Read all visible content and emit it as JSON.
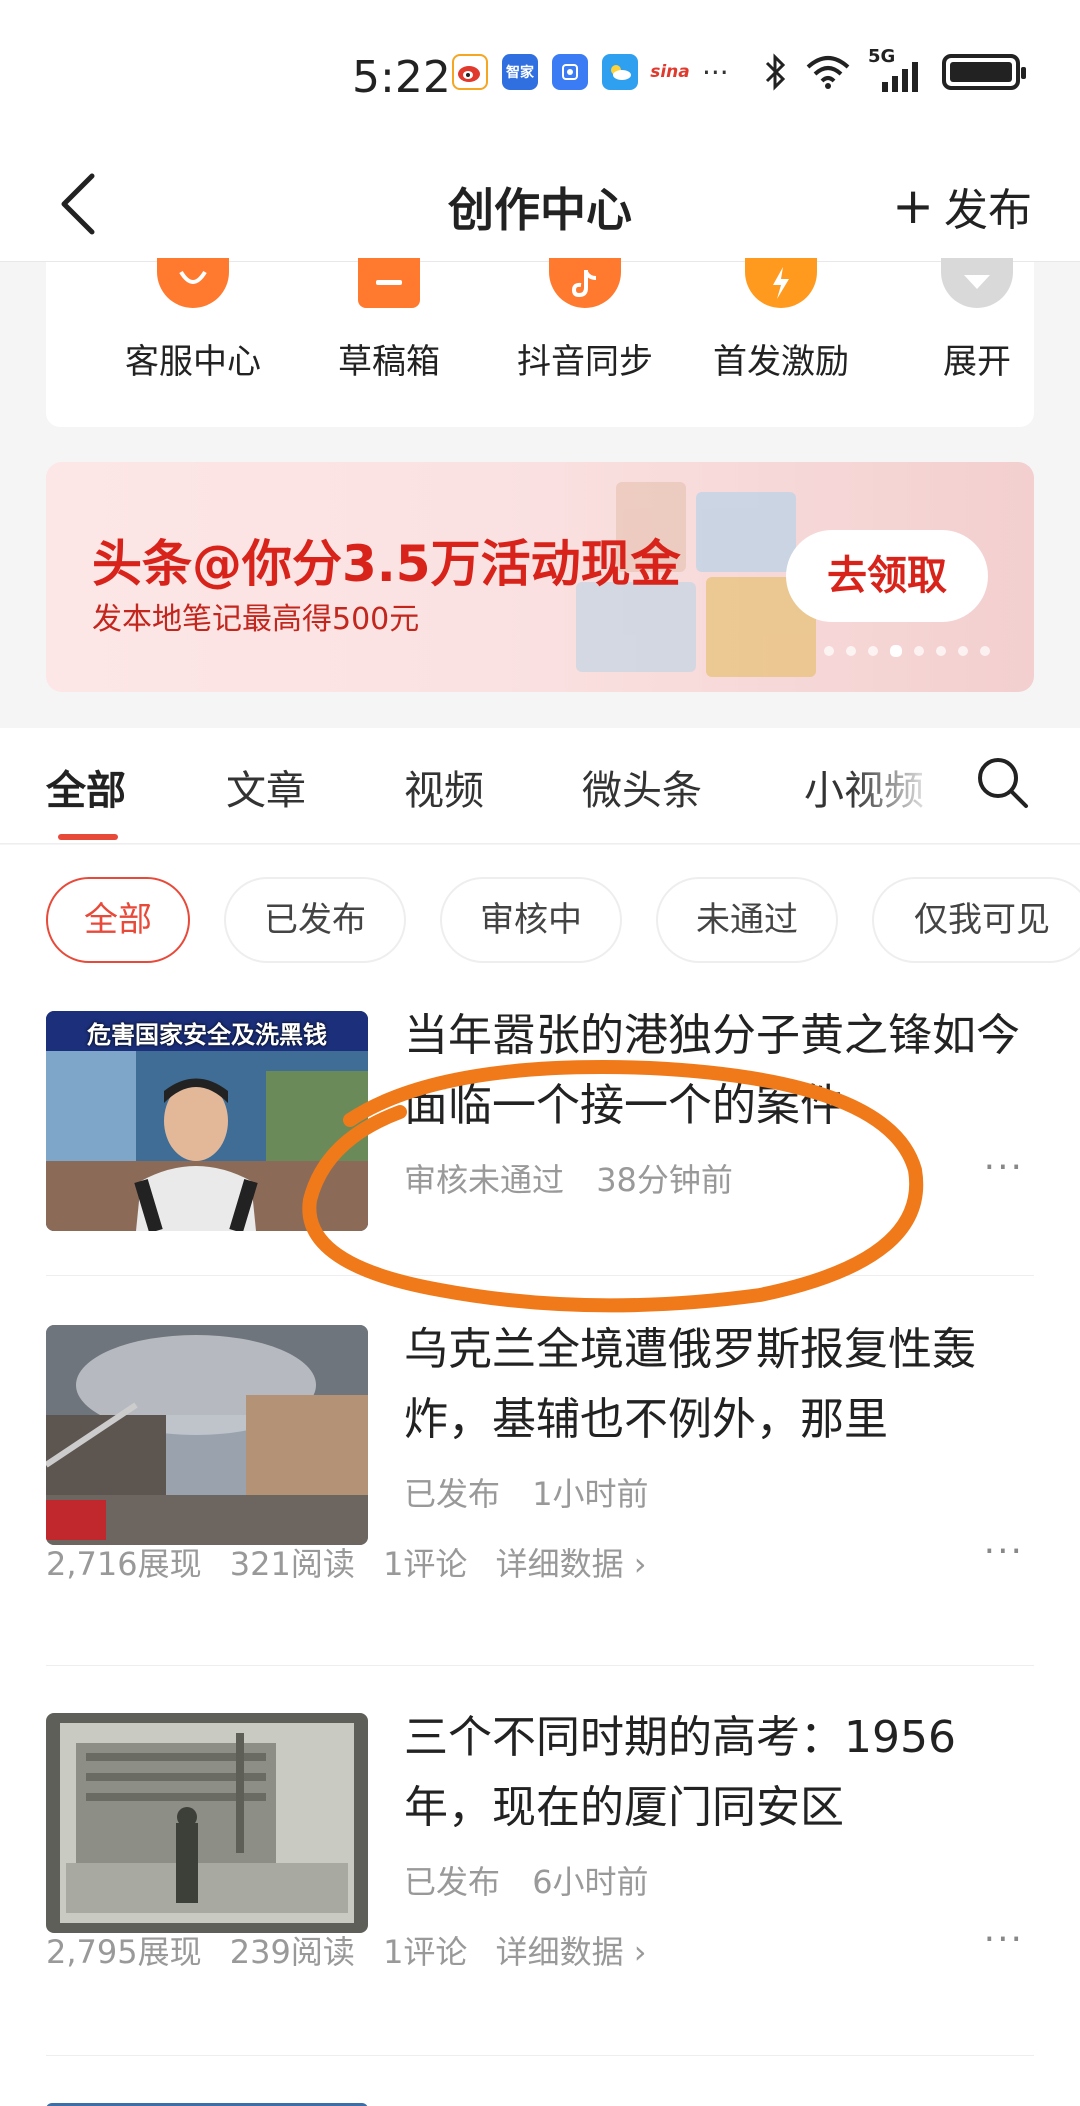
{
  "status_bar": {
    "time": "5:22",
    "apps": [
      {
        "icon": "weibo-app-icon",
        "color": "#f5a623"
      },
      {
        "icon": "zhijia-app-icon",
        "color": "#2f6fe0",
        "text": "智家"
      },
      {
        "icon": "hand-app-icon",
        "color": "#3b7cf5"
      },
      {
        "icon": "weather-app-icon",
        "color": "#2fa0f0"
      },
      {
        "icon": "sina-app-icon",
        "color": "#e03a2f",
        "text": "sina"
      }
    ],
    "more": "···",
    "network": "5G"
  },
  "header": {
    "title": "创作中心",
    "publish_label": "发布",
    "publish_icon": "plus-icon"
  },
  "tools": [
    {
      "label": "客服中心",
      "icon": "headset-icon",
      "color": "#ff7a2f"
    },
    {
      "label": "草稿箱",
      "icon": "draft-box-icon",
      "color": "#ff7a2f"
    },
    {
      "label": "抖音同步",
      "icon": "douyin-icon",
      "color": "#ff7a2f"
    },
    {
      "label": "首发激励",
      "icon": "incentive-icon",
      "color": "#ff9a1f"
    },
    {
      "label": "展开",
      "icon": "expand-icon",
      "color": "#d9d9d9"
    }
  ],
  "banner": {
    "title": "头条@你分3.5万活动现金",
    "subtitle": "发本地笔记最高得500元",
    "button": "去领取",
    "dot_count": 8,
    "active_dot": 3
  },
  "tabs": [
    "全部",
    "文章",
    "视频",
    "微头条",
    "小视频"
  ],
  "active_tab": 0,
  "filters": [
    "全部",
    "已发布",
    "审核中",
    "未通过",
    "仅我可见"
  ],
  "active_filter": 0,
  "items": [
    {
      "title": "当年嚣张的港独分子黄之锋如今面临一个接一个的案件",
      "thumb_caption": "危害国家安全及洗黑钱",
      "status": "审核未通过",
      "time": "38分钟前"
    },
    {
      "title": "乌克兰全境遭俄罗斯报复性轰炸，基辅也不例外，那里",
      "status": "已发布",
      "time": "1小时前",
      "views": "2,716展现",
      "reads": "321阅读",
      "comments": "1评论",
      "detail": "详细数据 ›"
    },
    {
      "title": "三个不同时期的高考：1956年，现在的厦门同安区",
      "status": "已发布",
      "time": "6小时前",
      "views": "2,795展现",
      "reads": "239阅读",
      "comments": "1评论",
      "detail": "详细数据 ›"
    }
  ],
  "more_label": "···",
  "colors": {
    "accent": "#e84a3a",
    "brand_red": "#d8231b",
    "tool_orange": "#ff7a2f",
    "annotation": "#f07a1a"
  }
}
